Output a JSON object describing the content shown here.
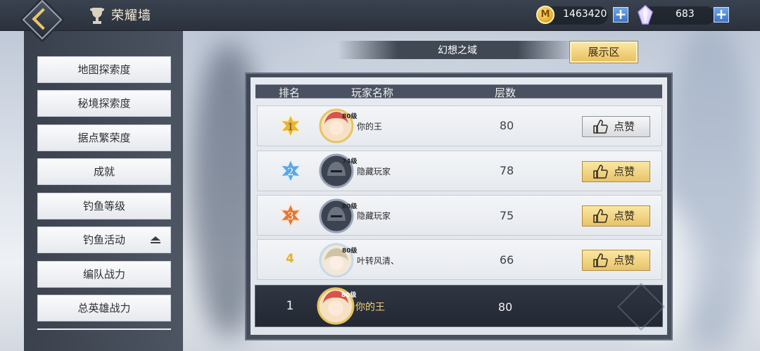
{
  "header": {
    "title": "荣耀墙",
    "coins": "1463420",
    "gems": "683",
    "coin_glyph": "M"
  },
  "sidebar": {
    "items": [
      {
        "label": "地图探索度"
      },
      {
        "label": "秘境探索度"
      },
      {
        "label": "据点繁荣度"
      },
      {
        "label": "成就"
      },
      {
        "label": "钓鱼等级"
      },
      {
        "label": "钓鱼活动",
        "locked": true
      },
      {
        "label": "编队战力"
      },
      {
        "label": "总英雄战力"
      }
    ]
  },
  "realm": {
    "title": "幻想之域",
    "show_button": "展示区"
  },
  "table": {
    "columns": [
      "排名",
      "玩家名称",
      "层数"
    ],
    "rows": [
      {
        "rank": "1",
        "name": "你的王",
        "level": "80级",
        "score": "80",
        "like": "点赞",
        "like_state": "disabled",
        "medal_color": "#e6b43c"
      },
      {
        "rank": "2",
        "name": "隐藏玩家",
        "level": "74级",
        "score": "78",
        "like": "点赞",
        "like_state": "active",
        "medal_color": "#5aa6e6"
      },
      {
        "rank": "3",
        "name": "隐藏玩家",
        "level": "80级",
        "score": "75",
        "like": "点赞",
        "like_state": "active",
        "medal_color": "#e07a36"
      },
      {
        "rank": "4",
        "name": "叶转风清、",
        "level": "80级",
        "score": "66",
        "like": "点赞",
        "like_state": "active"
      }
    ],
    "self": {
      "rank": "1",
      "name": "你的王",
      "level": "80级",
      "score": "80"
    }
  },
  "colors": {
    "accent_gold": "#e8c36a",
    "self_name": "#f0d27a",
    "rank4": "#e2b32c"
  }
}
